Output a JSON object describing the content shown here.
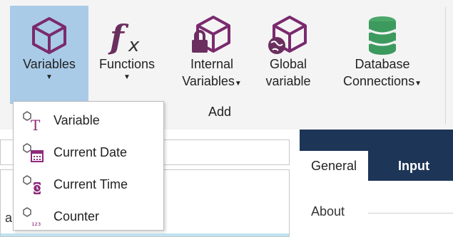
{
  "ribbon": {
    "buttons": [
      {
        "label": "Variables",
        "icon": "cube-icon",
        "has_dropdown": true,
        "active": true
      },
      {
        "label": "Functions",
        "icon": "function-fx-icon",
        "has_dropdown": true
      },
      {
        "label_line1": "Internal",
        "label_line2": "Variables",
        "icon": "internal-variable-lock-icon",
        "has_dropdown": true
      },
      {
        "label_line1": "Global",
        "label_line2": "variable",
        "icon": "global-variable-icon"
      },
      {
        "label_line1": "Database",
        "label_line2": "Connections",
        "icon": "database-icon",
        "has_dropdown": true
      }
    ],
    "group_label": "Add",
    "accent_active": "#a9cbe8"
  },
  "dropdown": {
    "items": [
      {
        "label": "Variable",
        "icon": "text-variable-icon"
      },
      {
        "label": "Current Date",
        "icon": "calendar-variable-icon"
      },
      {
        "label": "Current Time",
        "icon": "clock-variable-icon"
      },
      {
        "label": "Counter",
        "icon": "counter-variable-icon"
      }
    ]
  },
  "left_panel": {
    "list_fragment": "a"
  },
  "right_panel": {
    "tabs": [
      "General",
      "Input ru"
    ],
    "section_title": "About",
    "header_color": "#1d3557"
  }
}
